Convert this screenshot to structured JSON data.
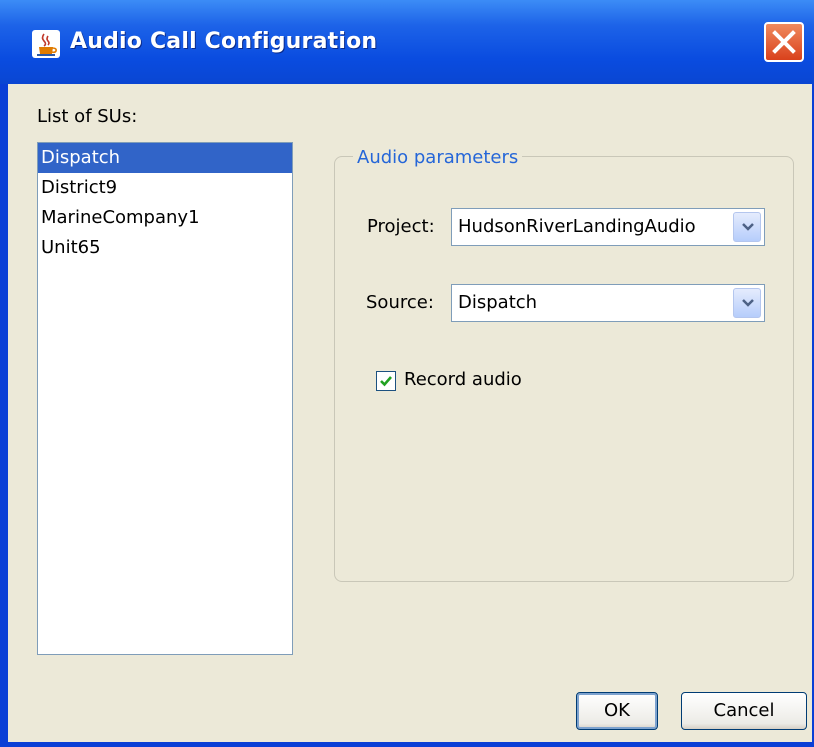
{
  "window": {
    "title": "Audio Call Configuration",
    "icons": {
      "app": "java-cup-icon",
      "close": "close-icon"
    }
  },
  "sus": {
    "label": "List of SUs:",
    "items": [
      "Dispatch",
      "District9",
      "MarineCompany1",
      "Unit65"
    ],
    "selected": "Dispatch"
  },
  "audio": {
    "legend": "Audio parameters",
    "project_label": "Project:",
    "project_value": "HudsonRiverLandingAudio",
    "source_label": "Source:",
    "source_value": "Dispatch",
    "record_label": "Record audio",
    "record_checked": true
  },
  "buttons": {
    "ok": "OK",
    "cancel": "Cancel"
  },
  "colors": {
    "titlebar": "#0a46d2",
    "selection": "#3164c8",
    "legend_text": "#2566d8",
    "dialog_bg": "#ece9d8",
    "close_button": "#d9411c"
  }
}
